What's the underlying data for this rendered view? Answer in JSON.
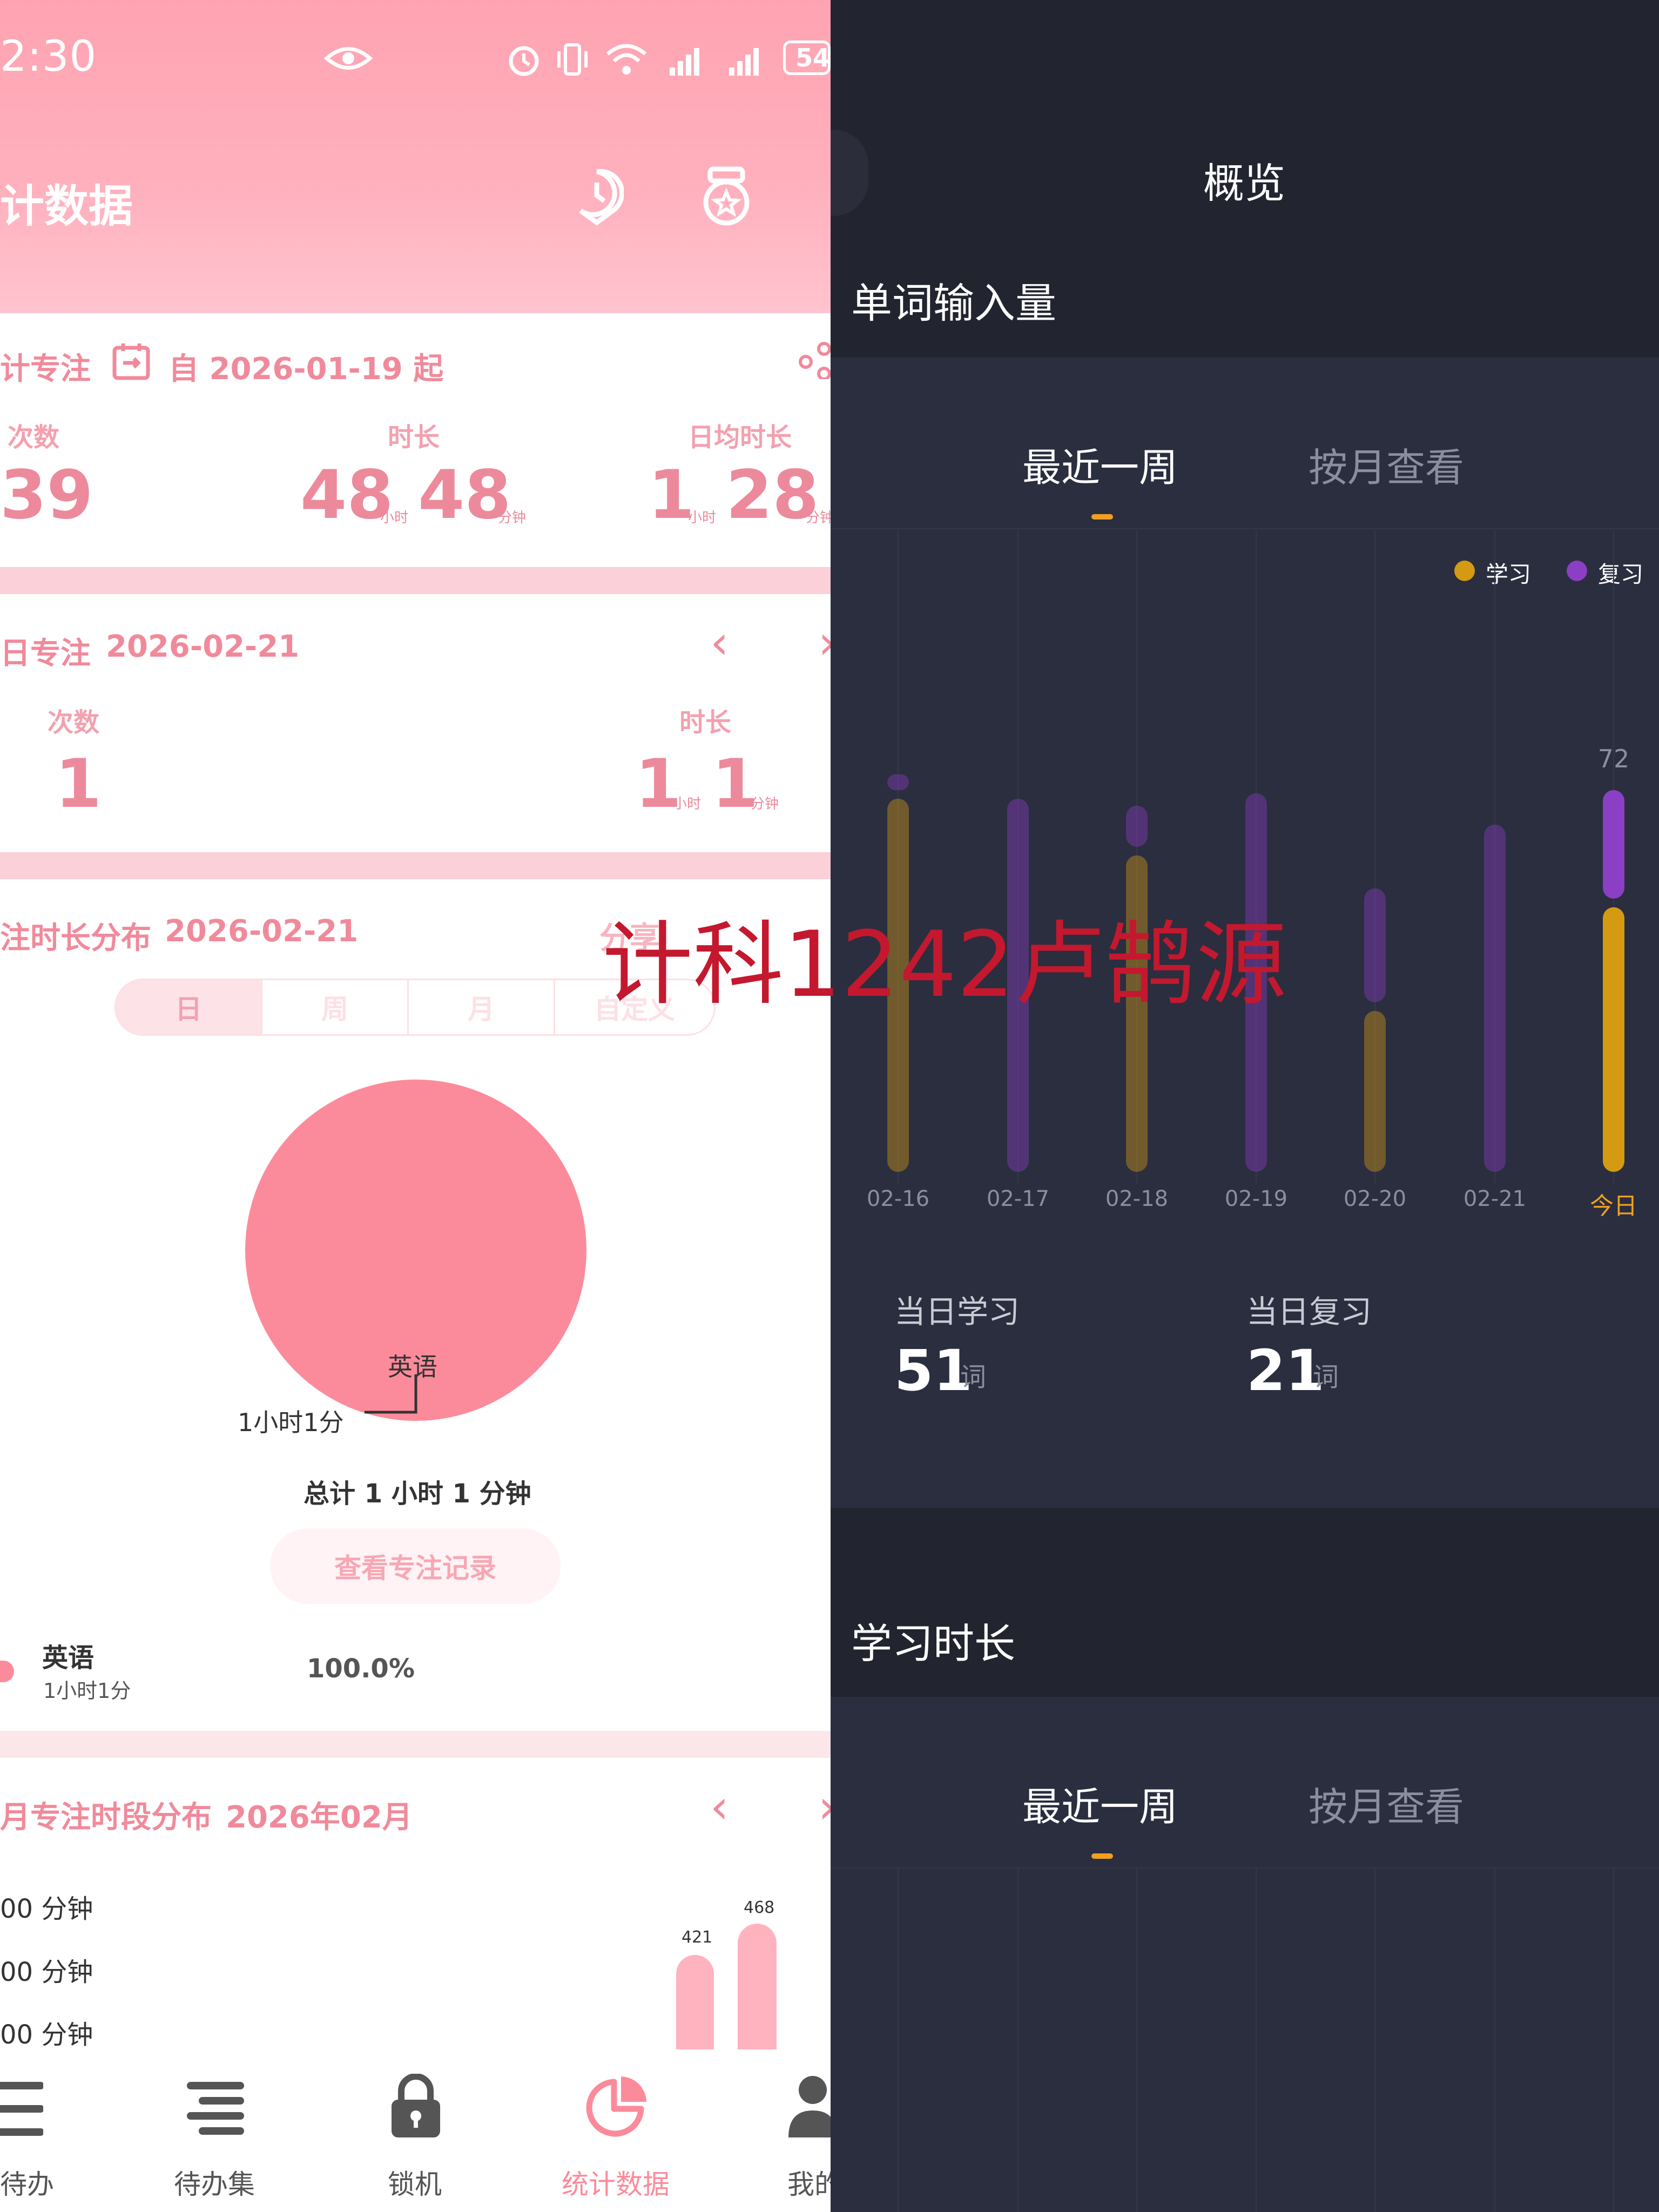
{
  "status_bar": {
    "time": "2:30",
    "battery": "54"
  },
  "left": {
    "title": "计数据",
    "stats_card": {
      "title": "计专注",
      "date_range": "自 2026-01-19 起",
      "count_label": "次数",
      "count_value": "39",
      "duration_label": "时长",
      "duration_hours": "48",
      "duration_minutes": "48",
      "daily_label": "日均时长",
      "daily_hours": "1",
      "daily_minutes": "28",
      "unit_hour": "小时",
      "unit_minute": "分钟",
      "unit_minute_cut": "分钟"
    },
    "today_card": {
      "title": "日专注",
      "date": "2026-02-21",
      "count_label": "次数",
      "count_value": "1",
      "duration_label": "时长",
      "duration_hours": "1",
      "duration_minutes": "1",
      "unit_hour": "小时",
      "unit_minute": "分钟"
    },
    "distribution_card": {
      "title": "注时长分布",
      "date": "2026-02-21",
      "share_cut": "分享",
      "segments": [
        "日",
        "周",
        "月",
        "自定义"
      ],
      "selected_segment": "日",
      "pie_label": "英语",
      "pie_value_label": "1小时1分",
      "total": "总计 1 小时 1 分钟",
      "view_records": "查看专注记录",
      "legend_name": "英语",
      "legend_time": "1小时1分",
      "legend_percent": "100.0%",
      "pie_color": "#fb8b9b"
    },
    "month_card": {
      "title": "月专注时段分布",
      "date": "2026年02月",
      "y_labels": [
        "00 分钟",
        "00 分钟",
        "00 分钟"
      ],
      "bar_values": [
        "421",
        "468"
      ]
    },
    "tabs": [
      "待办",
      "待办集",
      "锁机",
      "统计数据",
      "我的"
    ],
    "active_tab": "统计数据"
  },
  "right": {
    "header": "概览",
    "word_section": {
      "title": "单词输入量",
      "tabs": [
        "最近一周",
        "按月查看"
      ],
      "active_tab": "最近一周",
      "legend": [
        "学习",
        "复习"
      ],
      "today_total_label": "72",
      "today_study_label": "当日学习",
      "today_study_value": "51",
      "today_review_label": "当日复习",
      "today_review_value": "21",
      "word_unit": "词"
    },
    "time_section": {
      "title": "学习时长",
      "tabs": [
        "最近一周",
        "按月查看"
      ],
      "active_tab": "最近一周"
    },
    "colors": {
      "study": "#d49a12",
      "review": "#8b3fc4",
      "accent": "#f0a020"
    }
  },
  "chart_data": {
    "type": "bar",
    "categories": [
      "02-16",
      "02-17",
      "02-18",
      "02-19",
      "02-20",
      "02-21",
      "今日"
    ],
    "series": [
      {
        "name": "学习",
        "values": [
          72,
          0,
          61,
          0,
          31,
          0,
          51
        ]
      },
      {
        "name": "复习",
        "values": [
          3,
          72,
          8,
          73,
          22,
          67,
          21
        ]
      }
    ],
    "data_labels": {
      "今日": "72"
    }
  },
  "watermark": "计科1242卢鹄源"
}
